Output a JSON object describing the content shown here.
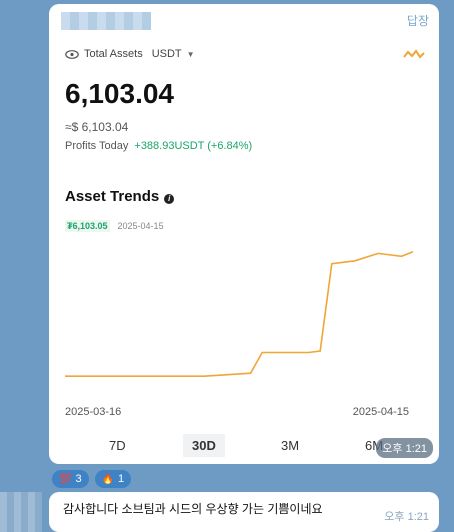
{
  "reply_label": "답장",
  "card": {
    "total_assets_label": "Total Assets",
    "currency": "USDT",
    "balance": "6,103.04",
    "approx": "≈$ 6,103.04",
    "profits_label": "Profits Today",
    "profits_value": "+388.93USDT (+6.84%)",
    "trends_title": "Asset Trends",
    "point_value": "₮6,103.05",
    "point_date": "2025-04-15",
    "x_start": "2025-03-16",
    "x_end": "2025-04-15",
    "tabs": [
      "7D",
      "30D",
      "3M",
      "6M"
    ],
    "active_tab": "30D",
    "time": "오후 1:21"
  },
  "chart_data": {
    "type": "line",
    "x": [
      "2025-03-16",
      "2025-03-22",
      "2025-03-28",
      "2025-04-01",
      "2025-04-02",
      "2025-04-06",
      "2025-04-07",
      "2025-04-08",
      "2025-04-10",
      "2025-04-12",
      "2025-04-14",
      "2025-04-15"
    ],
    "values": [
      1900,
      1900,
      1900,
      2000,
      2700,
      2700,
      2750,
      5700,
      5800,
      6050,
      5950,
      6103.05
    ],
    "xlabel": "",
    "ylabel": "",
    "color": "#f0a535"
  },
  "reactions": [
    {
      "emoji": "💯",
      "count": "3"
    },
    {
      "emoji": "🔥",
      "count": "1"
    }
  ],
  "message2": {
    "text": "감사합니다 소브팀과 시드의 우상향 가는 기쁨이네요",
    "time": "오후 1:21"
  },
  "colors": {
    "accent_green": "#1aa56a",
    "line": "#f0a535",
    "bg": "#6e9bc4"
  }
}
